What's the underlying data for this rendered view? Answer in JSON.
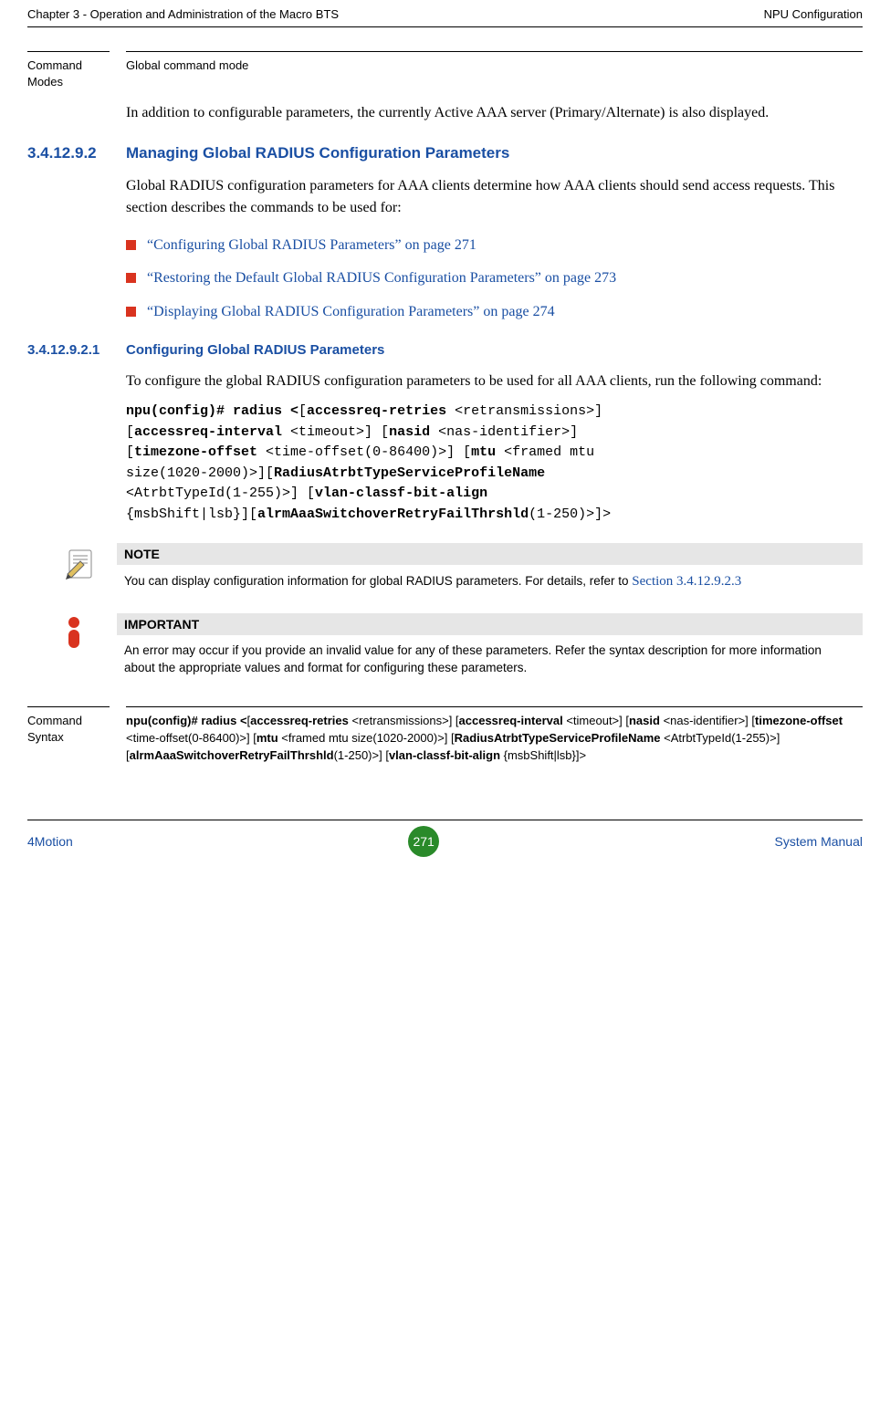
{
  "header": {
    "left": "Chapter 3 - Operation and Administration of the Macro BTS",
    "right": "NPU Configuration"
  },
  "cmdModes": {
    "label": "Command Modes",
    "value": "Global command mode"
  },
  "intro_para": "In addition to configurable parameters, the currently Active AAA server (Primary/Alternate) is also displayed.",
  "sec1": {
    "num": "3.4.12.9.2",
    "title": "Managing Global RADIUS Configuration Parameters",
    "para": "Global RADIUS configuration parameters for AAA clients determine how AAA clients should send access requests. This section describes the commands to be used for:"
  },
  "bullets": {
    "b1": "“Configuring Global RADIUS Parameters” on page 271",
    "b2": "“Restoring the Default Global RADIUS Configuration Parameters” on page 273",
    "b3": "“Displaying Global RADIUS Configuration Parameters” on page 274"
  },
  "sec2": {
    "num": "3.4.12.9.2.1",
    "title": "Configuring Global RADIUS Parameters",
    "para": "To configure the global RADIUS configuration parameters to be used for all AAA clients, run the following command:"
  },
  "cmd": {
    "l1a": "npu(config)# radius <",
    "l1b": "accessreq-retries",
    "l1c": " <retransmissions>] ",
    "l2a": "[",
    "l2b": "accessreq-interval",
    "l2c": " <timeout>] [",
    "l2d": "nasid",
    "l2e": " <nas-identifier>] ",
    "l3a": "[",
    "l3b": "timezone-offset",
    "l3c": " <time-offset(0-86400)>] [",
    "l3d": "mtu",
    "l3e": " <framed mtu ",
    "l4a": "size(1020-2000)>][",
    "l4b": "RadiusAtrbtTypeServiceProfileName",
    "l5a": "<AtrbtTypeId(1-255)>] [",
    "l5b": "vlan-classf-bit-align",
    "l6a": "{msbShift|lsb}][",
    "l6b": "alrmAaaSwitchoverRetryFailThrshld",
    "l6c": "(1-250)>]>"
  },
  "note": {
    "head": "NOTE",
    "text": "You can display configuration information for global RADIUS parameters. For details, refer to ",
    "link": "Section 3.4.12.9.2.3"
  },
  "important": {
    "head": "IMPORTANT",
    "text": "An error may occur if you provide an invalid value for any of these parameters. Refer the syntax description for more information about the appropriate values and format for configuring these parameters."
  },
  "cmdSyntax": {
    "label": "Command Syntax",
    "v": {
      "p1": "npu(config)# radius <",
      "p2": "accessreq-retries",
      "p3": " <retransmissions>] [",
      "p4": "accessreq-interval",
      "p5": " <timeout>] [",
      "p6": "nasid",
      "p7": " <nas-identifier>] [",
      "p8": "timezone-offset",
      "p9": " <time-offset(0-86400)>] [",
      "p10": "mtu",
      "p11": " <framed mtu size(1020-2000)>] [",
      "p12": "RadiusAtrbtTypeServiceProfileName",
      "p13": " <AtrbtTypeId(1-255)>] [",
      "p14": "alrmAaaSwitchoverRetryFailThrshld",
      "p15": "(1-250)>] [",
      "p16": "vlan-classf-bit-align",
      "p17": " {msbShift|lsb}]>"
    }
  },
  "footer": {
    "left": "4Motion",
    "page": "271",
    "right": "System Manual"
  }
}
